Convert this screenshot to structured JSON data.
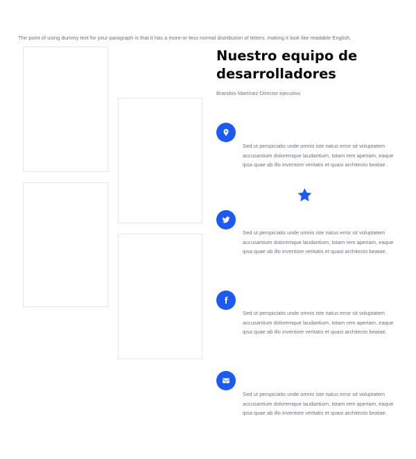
{
  "intro_text": "The point of using dummy text for your paragraph is that it has a more-or-less normal distribution of letters. making it look like readable English.",
  "heading": "Nuestro equipo de desarrolladores",
  "subheading": "Brandon Martínez Director ejecutivo",
  "accent_color": "#1b5af5",
  "features": [
    {
      "icon": "map-pin-icon",
      "text": "Sed ut perspiciatis unde omnis iste natus error sit voluptatem accusantium doloremque laudantium, totam rem aperiam, eaque ipsa quae ab illo inventore veritatis et quasi architecto beatae ."
    },
    {
      "icon": "twitter-icon",
      "text": "Sed ut perspiciatis unde omnis iste natus error sit voluptatem accusantium doloremque laudantium, totam rem aperiam, eaque ipsa quae ab illo inventore veritatis et quasi architecto beatae."
    },
    {
      "icon": "facebook-icon",
      "text": "Sed ut perspiciatis unde omnis iste natus error sit voluptatem accusantium doloremque laudantium, totam rem aperiam, eaque ipsa quae ab illo inventore veritatis et quasi architecto beatae."
    },
    {
      "icon": "envelope-icon",
      "text": "Sed ut perspiciatis unde omnis iste natus error sit voluptatem accusantium doloremque laudantium, totam rem aperiam, eaque ipsa quae ab illo inventore veritatis et quasi architecto beatae."
    }
  ],
  "decorations": {
    "star_icon": "star-icon"
  }
}
